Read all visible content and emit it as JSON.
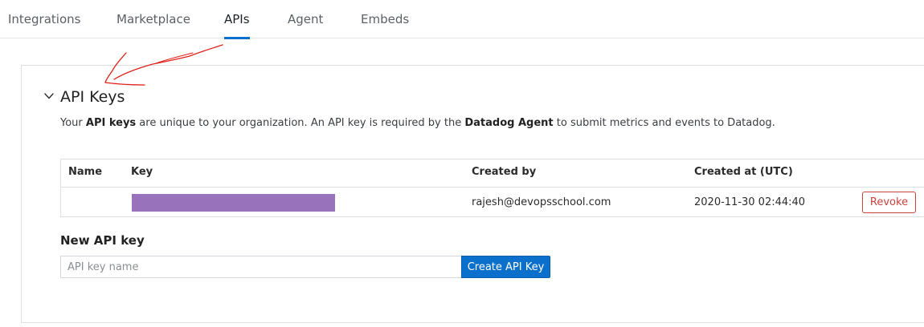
{
  "tabs": [
    {
      "label": "Integrations",
      "active": false
    },
    {
      "label": "Marketplace",
      "active": false
    },
    {
      "label": "APIs",
      "active": true
    },
    {
      "label": "Agent",
      "active": false
    },
    {
      "label": "Embeds",
      "active": false
    }
  ],
  "section": {
    "title": "API Keys",
    "description": {
      "part1": "Your ",
      "bold1": "API keys",
      "part2": " are unique to your organization. An API key is required by the ",
      "bold2": "Datadog Agent",
      "part3": " to submit metrics and events to Datadog."
    }
  },
  "table": {
    "headers": {
      "name": "Name",
      "key": "Key",
      "created_by": "Created by",
      "created_at": "Created at (UTC)"
    },
    "rows": [
      {
        "name": "",
        "created_by": "rajesh@devopsschool.com",
        "created_at": "2020-11-30 02:44:40",
        "action": "Revoke"
      }
    ]
  },
  "new_key": {
    "label": "New API key",
    "placeholder": "API key name",
    "value": "",
    "button": "Create API Key"
  },
  "colors": {
    "accent": "#0b6fcc",
    "revoke": "#c9433d",
    "redacted_key": "#9872bb",
    "annotation": "#e0201a"
  },
  "icons": {
    "collapse": "chevron-down-icon"
  }
}
